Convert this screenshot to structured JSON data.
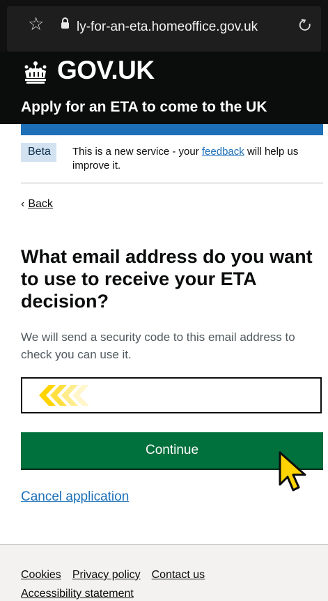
{
  "browser": {
    "url": "ly-for-an-eta.homeoffice.gov.uk"
  },
  "header": {
    "logo_text": "GOV.UK",
    "service_name": "Apply for an ETA to come to the UK"
  },
  "phase_banner": {
    "tag": "Beta",
    "text_before": "This is a new service - your ",
    "link_text": "feedback",
    "text_after": " will help us improve it."
  },
  "navigation": {
    "back_label": "Back"
  },
  "form": {
    "heading": "What email address do you want to use to receive your ETA decision?",
    "hint": "We will send a security code to this email address to check you can use it.",
    "email_value": "",
    "continue_label": "Continue",
    "cancel_label": "Cancel application"
  },
  "footer": {
    "links": [
      "Cookies",
      "Privacy policy",
      "Contact us"
    ],
    "accessibility_label": "Accessibility statement"
  },
  "icons": {
    "star": "bookmark-star-icon",
    "lock": "lock-icon",
    "reload": "reload-icon",
    "crown": "crown-icon",
    "chevrons": "chevrons-left-icon",
    "cursor": "mouse-pointer-icon"
  },
  "colors": {
    "header_bg": "#0b0c0c",
    "brand_blue": "#1d70b8",
    "button_green": "#00703c",
    "tag_bg": "#d2e2f1",
    "chevron_yellow": "#ffd400",
    "footer_bg": "#f3f2f1"
  }
}
